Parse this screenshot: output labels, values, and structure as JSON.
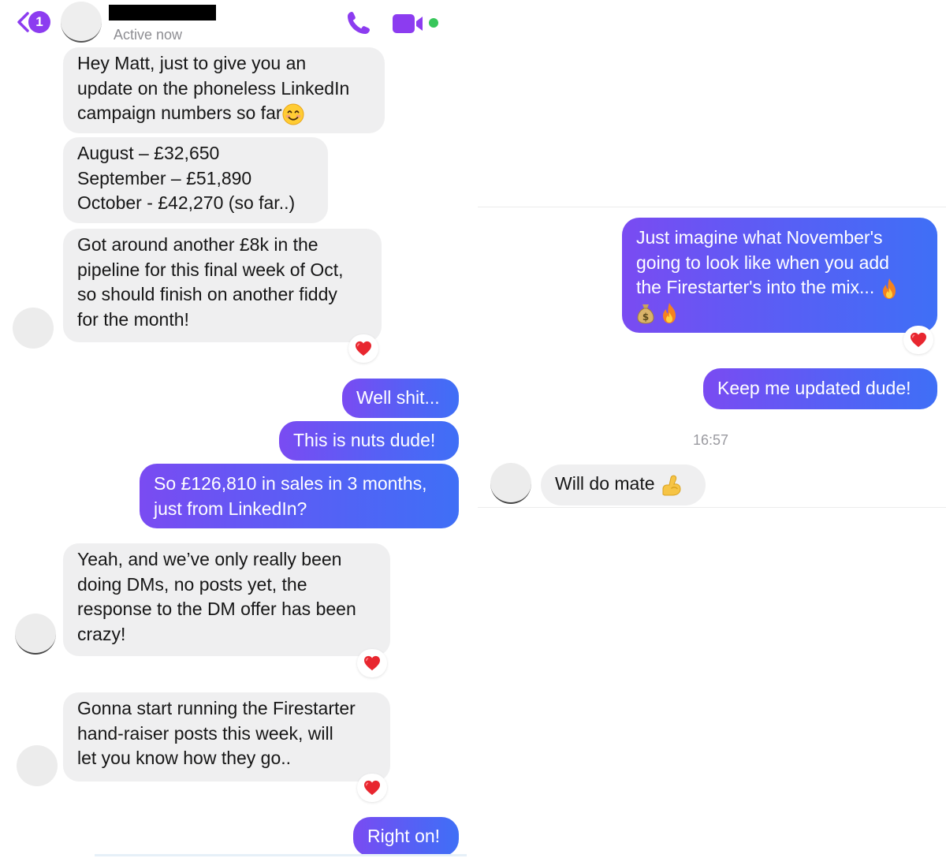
{
  "header": {
    "unread_count": "1",
    "status": "Active now"
  },
  "left_messages": [
    {
      "lines": [
        "Hey Matt, just to give you an",
        "update on the phoneless LinkedIn",
        "campaign numbers so far"
      ]
    },
    {
      "lines": [
        "August – £32,650",
        "September – £51,890",
        "October - £42,270 (so far..)"
      ]
    },
    {
      "lines": [
        "Got around another £8k in the",
        "pipeline for this final week of Oct,",
        "so should finish on another fiddy",
        "for the month!"
      ]
    },
    {
      "lines": [
        "Well shit..."
      ]
    },
    {
      "lines": [
        "This is nuts dude!"
      ]
    },
    {
      "lines": [
        "So £126,810 in sales in 3 months,",
        "just from LinkedIn?"
      ]
    },
    {
      "lines": [
        "Yeah, and we’ve only really been",
        "doing DMs, no posts yet, the",
        "response to the DM offer has been",
        "crazy!"
      ]
    },
    {
      "lines": [
        "Gonna start running the Firestarter",
        "hand-raiser posts this week, will",
        "let you know how they go.."
      ]
    },
    {
      "lines": [
        "Right on!"
      ]
    }
  ],
  "right_messages": [
    {
      "lines": [
        "Just imagine what November's",
        "going to look like when you add",
        "the Firestarter's into the mix..."
      ]
    },
    {
      "lines": [
        "Keep me updated dude!"
      ]
    },
    {
      "lines": [
        "Will do mate"
      ]
    }
  ],
  "timestamp": "16:57",
  "icons": {
    "back": "chevron-left-icon",
    "call": "phone-icon",
    "video": "video-camera-icon",
    "reaction": "heart-icon",
    "emoji_smile": "smiling-face-icon",
    "emoji_fire": "fire-icon",
    "emoji_money": "money-bag-icon",
    "emoji_flex": "flexed-biceps-icon"
  },
  "colors": {
    "accent": "#8c3cf0",
    "outgoing_start": "#7a4bf2",
    "outgoing_end": "#3f6ff6",
    "incoming": "#efeff0",
    "online": "#37c65a",
    "heart": "#e8262f"
  }
}
